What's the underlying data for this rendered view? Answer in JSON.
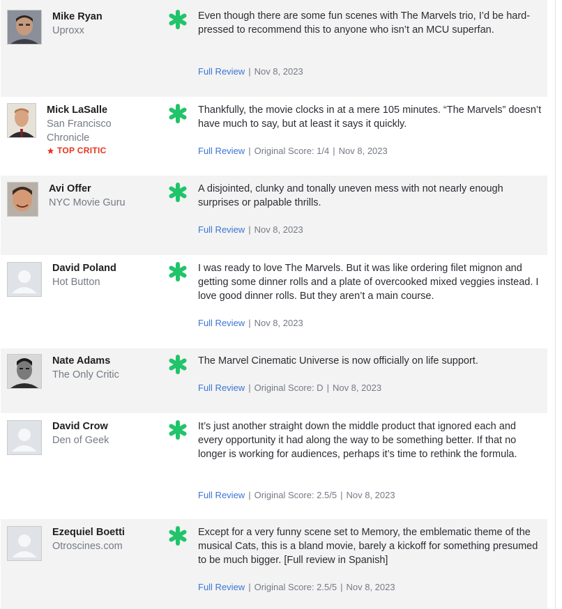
{
  "colors": {
    "accent_link": "#3b74d7",
    "top_critic_red": "#e6331e",
    "fresh_splat_green": "#21c46a",
    "row_shade": "#f3f3f3"
  },
  "icons": {
    "score": "green-splat-icon",
    "top_critic": "star-icon",
    "default_avatar": "person-placeholder-icon"
  },
  "reviews": [
    {
      "critic": "Mike Ryan",
      "publication": "Uproxx",
      "top_critic": "",
      "quote": "Even though there are some fun scenes with The Marvels trio, I’d be hard-pressed to recommend this to anyone who isn’t an MCU superfan.",
      "link": "Full Review",
      "score": "",
      "date": "Nov 8, 2023"
    },
    {
      "critic": "Mick LaSalle",
      "publication": "San Francisco Chronicle",
      "top_critic": "TOP CRITIC",
      "quote": "Thankfully, the movie clocks in at a mere 105 minutes. “The Marvels” doesn’t have much to say, but at least it says it quickly.",
      "link": "Full Review",
      "score": "Original Score: 1/4",
      "date": "Nov 8, 2023"
    },
    {
      "critic": "Avi Offer",
      "publication": "NYC Movie Guru",
      "top_critic": "",
      "quote": "A disjointed, clunky and tonally uneven mess with not nearly enough surprises or palpable thrills.",
      "link": "Full Review",
      "score": "",
      "date": "Nov 8, 2023"
    },
    {
      "critic": "David Poland",
      "publication": "Hot Button",
      "top_critic": "",
      "quote": "I was ready to love The Marvels. But it was like ordering filet mignon and getting some dinner rolls and a plate of overcooked mixed veggies instead. I love good dinner rolls. But they aren’t a main course.",
      "link": "Full Review",
      "score": "",
      "date": "Nov 8, 2023"
    },
    {
      "critic": "Nate Adams",
      "publication": "The Only Critic",
      "top_critic": "",
      "quote": "The Marvel Cinematic Universe is now officially on life support.",
      "link": "Full Review",
      "score": "Original Score: D",
      "date": "Nov 8, 2023"
    },
    {
      "critic": "David Crow",
      "publication": "Den of Geek",
      "top_critic": "",
      "quote": "It’s just another straight down the middle product that ignored each and every opportunity it had along the way to be something better. If that no longer is working for audiences, perhaps it’s time to rethink the formula.",
      "link": "Full Review",
      "score": "Original Score: 2.5/5",
      "date": "Nov 8, 2023"
    },
    {
      "critic": "Ezequiel Boetti",
      "publication": "Otroscines.com",
      "top_critic": "",
      "quote": "Except for a very funny scene set to Memory, the emblematic theme of the musical Cats, this is a bland movie, barely a kickoff for something presumed to be much bigger. [Full review in Spanish]",
      "link": "Full Review",
      "score": "Original Score: 2.5/5",
      "date": "Nov 8, 2023"
    }
  ]
}
